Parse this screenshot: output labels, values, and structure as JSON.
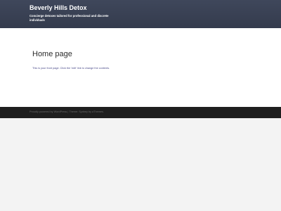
{
  "header": {
    "site_title": "Beverly Hills Detox",
    "site_description": "Concierge detoxes tailored for professional and discrete individuals"
  },
  "main": {
    "page_title": "Home page",
    "page_content": "This is your front page. Click the 'edit' link to change the contents."
  },
  "footer": {
    "credits": "Proudly powered by WordPress | Theme: Sydney by aThemes."
  },
  "colors": {
    "header_bg": "#3b4356",
    "body_bg": "#f3f3f3",
    "content_bg": "#ffffff",
    "footer_bg": "#1f1f1f"
  }
}
